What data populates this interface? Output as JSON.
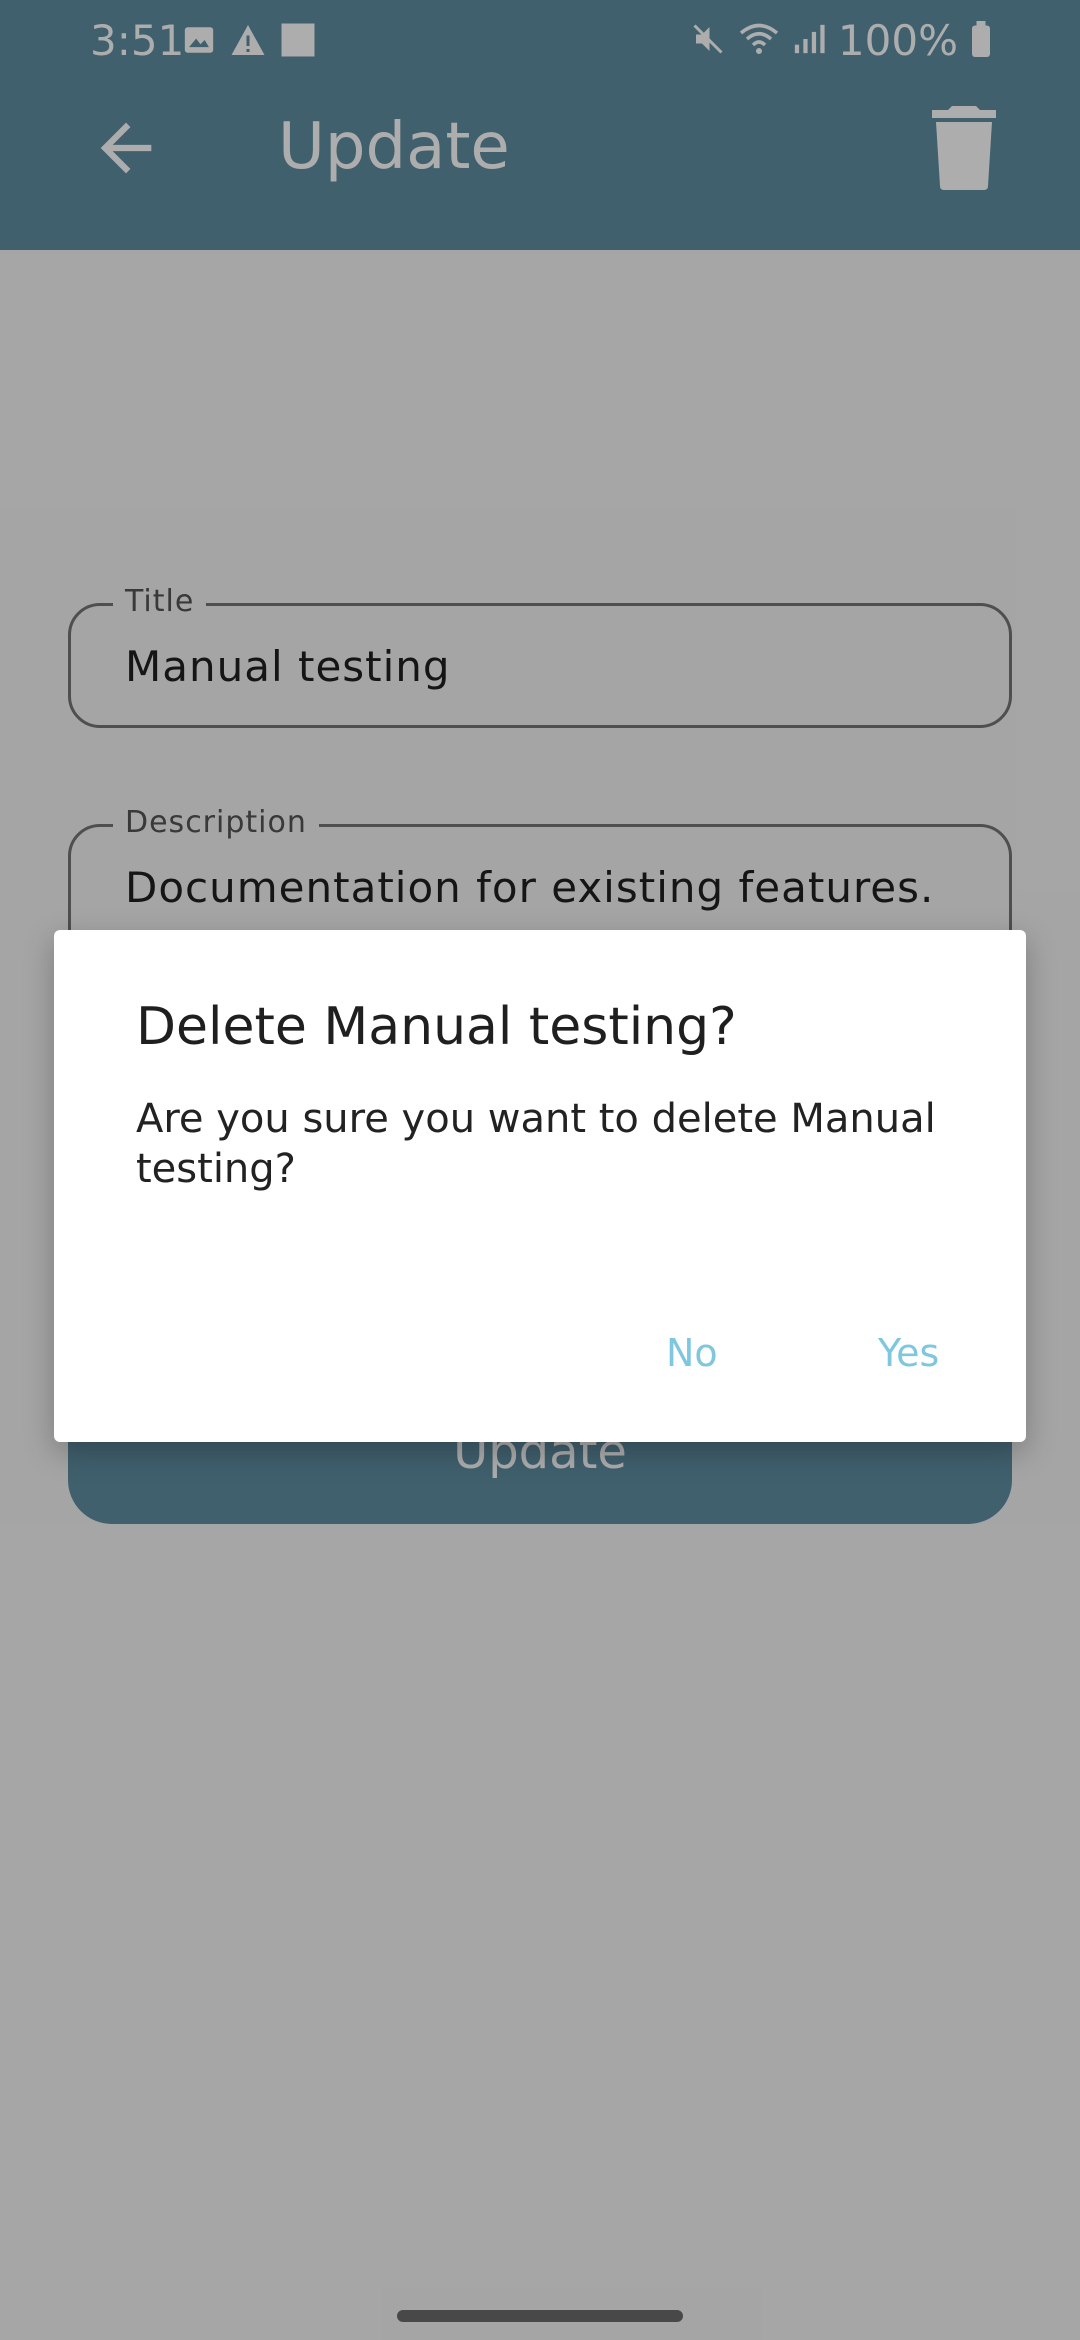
{
  "status_bar": {
    "time": "3:51",
    "battery": "100%",
    "left_icons": [
      "image-icon",
      "warning-icon",
      "square-icon"
    ],
    "right_icons": [
      "mute-icon",
      "wifi-icon",
      "signal-icon",
      "battery-icon"
    ]
  },
  "app_bar": {
    "title": "Update",
    "back_icon": "arrow-back-icon",
    "delete_icon": "trash-icon"
  },
  "form": {
    "title_label": "Title",
    "title_value": "Manual testing",
    "description_label": "Description",
    "description_value": "Documentation for existing features.",
    "update_button": "Update"
  },
  "dialog": {
    "title": "Delete Manual testing?",
    "message": "Are you sure you want to delete Manual testing?",
    "no_label": "No",
    "yes_label": "Yes"
  },
  "colors": {
    "app_bar": "#5f8ea3",
    "dialog_button": "#7fc6df",
    "scrim": "rgba(0,0,0,0.32)"
  }
}
